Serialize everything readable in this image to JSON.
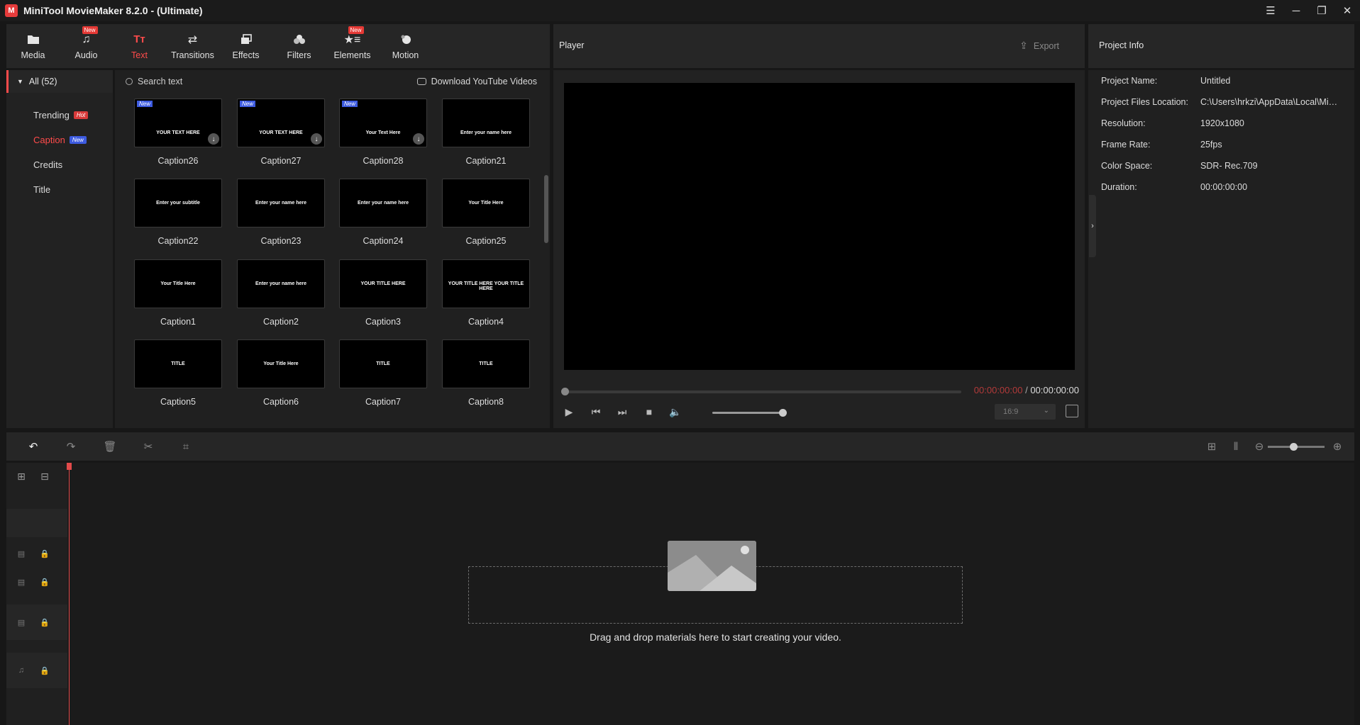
{
  "window": {
    "title": "MiniTool MovieMaker 8.2.0 - (Ultimate)",
    "logo_text": "M"
  },
  "toolbar": {
    "items": [
      {
        "label": "Media",
        "icon": "folder-icon",
        "badge": ""
      },
      {
        "label": "Audio",
        "icon": "music-note-icon",
        "badge": "New"
      },
      {
        "label": "Text",
        "icon": "text-icon",
        "badge": ""
      },
      {
        "label": "Transitions",
        "icon": "transitions-icon",
        "badge": ""
      },
      {
        "label": "Effects",
        "icon": "effects-icon",
        "badge": ""
      },
      {
        "label": "Filters",
        "icon": "filters-icon",
        "badge": ""
      },
      {
        "label": "Elements",
        "icon": "elements-icon",
        "badge": "New"
      },
      {
        "label": "Motion",
        "icon": "motion-icon",
        "badge": ""
      }
    ],
    "active": "Text"
  },
  "categories": {
    "all_label": "All (52)",
    "items": [
      {
        "label": "Trending",
        "tag": "Hot"
      },
      {
        "label": "Caption",
        "tag": "New"
      },
      {
        "label": "Credits",
        "tag": ""
      },
      {
        "label": "Title",
        "tag": ""
      }
    ],
    "active": "Caption"
  },
  "library": {
    "search_placeholder": "Search text",
    "youtube_link": "Download YouTube Videos",
    "new_badge": "New",
    "cards": [
      {
        "label": "Caption26",
        "preview": "YOUR TEXT HERE",
        "is_new": true
      },
      {
        "label": "Caption27",
        "preview": "YOUR TEXT HERE",
        "is_new": true
      },
      {
        "label": "Caption28",
        "preview": "Your Text Here",
        "is_new": true
      },
      {
        "label": "Caption21",
        "preview": "Enter your name here",
        "is_new": false
      },
      {
        "label": "Caption22",
        "preview": "Enter your subtitle",
        "is_new": false
      },
      {
        "label": "Caption23",
        "preview": "Enter your name here",
        "is_new": false
      },
      {
        "label": "Caption24",
        "preview": "Enter your name here",
        "is_new": false
      },
      {
        "label": "Caption25",
        "preview": "Your Title Here",
        "is_new": false
      },
      {
        "label": "Caption1",
        "preview": "Your Title Here",
        "is_new": false
      },
      {
        "label": "Caption2",
        "preview": "Enter your name here",
        "is_new": false
      },
      {
        "label": "Caption3",
        "preview": "YOUR TITLE HERE",
        "is_new": false
      },
      {
        "label": "Caption4",
        "preview": "YOUR TITLE HERE YOUR TITLE HERE",
        "is_new": false
      },
      {
        "label": "Caption5",
        "preview": "TITLE",
        "is_new": false
      },
      {
        "label": "Caption6",
        "preview": "Your Title Here",
        "is_new": false
      },
      {
        "label": "Caption7",
        "preview": "TITLE",
        "is_new": false
      },
      {
        "label": "Caption8",
        "preview": "TITLE",
        "is_new": false
      }
    ]
  },
  "player": {
    "title": "Player",
    "export_label": "Export",
    "current_time": "00:00:00:00",
    "separator": " / ",
    "total_time": "00:00:00:00",
    "aspect_ratio": "16:9",
    "volume": 1.0,
    "progress": 0.0
  },
  "project_info": {
    "title": "Project Info",
    "rows": [
      {
        "key": "Project Name:",
        "value": "Untitled"
      },
      {
        "key": "Project Files Location:",
        "value": "C:\\Users\\hrkzi\\AppData\\Local\\Mini..."
      },
      {
        "key": "Resolution:",
        "value": "1920x1080"
      },
      {
        "key": "Frame Rate:",
        "value": "25fps"
      },
      {
        "key": "Color Space:",
        "value": "SDR- Rec.709"
      },
      {
        "key": "Duration:",
        "value": "00:00:00:00"
      }
    ]
  },
  "timeline": {
    "zoom_level": 0.45,
    "drop_hint": "Drag and drop materials here to start creating your video."
  },
  "colors": {
    "accent": "#ff4b4b",
    "new_badge": "#3d5be0",
    "hot_badge": "#d83a3a"
  }
}
